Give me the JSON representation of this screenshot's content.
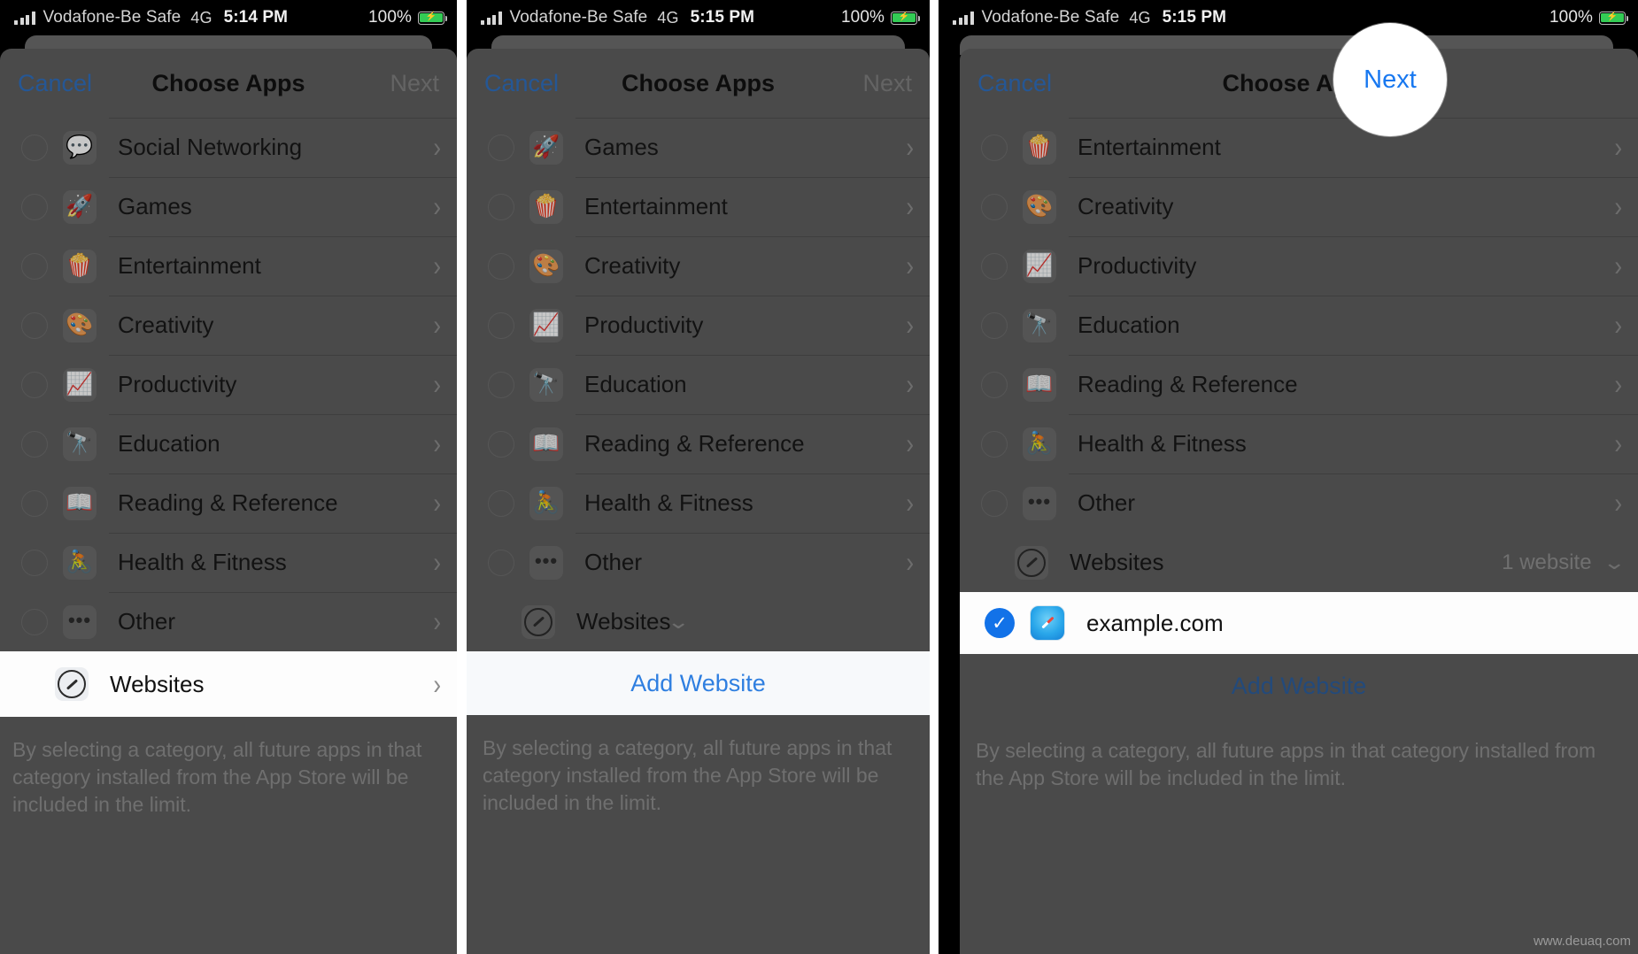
{
  "status_bar": {
    "signal_icon": "cellular-bars-icon",
    "carrier": "Vodafone-Be Safe",
    "network": "4G",
    "time_panel1": "5:14 PM",
    "time_panel2": "5:15 PM",
    "time_panel3": "5:15 PM",
    "battery_percent": "100%",
    "battery_icon": "battery-charging-icon"
  },
  "nav": {
    "cancel_label": "Cancel",
    "title": "Choose Apps",
    "next_label": "Next",
    "next_color_disabled": "#808080",
    "next_color_enabled": "#1878f0",
    "cancel_color": "#2f6fbf"
  },
  "footnote": "By selecting a category, all future apps in that category installed from the App Store will be included in the limit.",
  "add_website_label": "Add Website",
  "panel1": {
    "rows": [
      {
        "label": "Social Networking",
        "icon": "social-networking-icon",
        "glyph": "💬",
        "accessory": "chevron-right-icon"
      },
      {
        "label": "Games",
        "icon": "games-icon",
        "glyph": "🚀",
        "accessory": "chevron-right-icon"
      },
      {
        "label": "Entertainment",
        "icon": "entertainment-icon",
        "glyph": "🍿",
        "accessory": "chevron-right-icon"
      },
      {
        "label": "Creativity",
        "icon": "creativity-icon",
        "glyph": "🎨",
        "accessory": "chevron-right-icon"
      },
      {
        "label": "Productivity",
        "icon": "productivity-icon",
        "glyph": "📈",
        "accessory": "chevron-right-icon"
      },
      {
        "label": "Education",
        "icon": "education-icon",
        "glyph": "🔭",
        "accessory": "chevron-right-icon"
      },
      {
        "label": "Reading & Reference",
        "icon": "reading-reference-icon",
        "glyph": "📖",
        "accessory": "chevron-right-icon"
      },
      {
        "label": "Health & Fitness",
        "icon": "health-fitness-icon",
        "glyph": "🚴",
        "accessory": "chevron-right-icon"
      },
      {
        "label": "Other",
        "icon": "other-icon",
        "glyph": "•••",
        "accessory": "chevron-right-icon"
      }
    ],
    "websites_row": {
      "label": "Websites",
      "icon": "safari-compass-icon",
      "accessory": "chevron-right-icon",
      "highlighted": true
    }
  },
  "panel2": {
    "rows": [
      {
        "label": "Games",
        "icon": "games-icon",
        "glyph": "🚀",
        "accessory": "chevron-right-icon"
      },
      {
        "label": "Entertainment",
        "icon": "entertainment-icon",
        "glyph": "🍿",
        "accessory": "chevron-right-icon"
      },
      {
        "label": "Creativity",
        "icon": "creativity-icon",
        "glyph": "🎨",
        "accessory": "chevron-right-icon"
      },
      {
        "label": "Productivity",
        "icon": "productivity-icon",
        "glyph": "📈",
        "accessory": "chevron-right-icon"
      },
      {
        "label": "Education",
        "icon": "education-icon",
        "glyph": "🔭",
        "accessory": "chevron-right-icon"
      },
      {
        "label": "Reading & Reference",
        "icon": "reading-reference-icon",
        "glyph": "📖",
        "accessory": "chevron-right-icon"
      },
      {
        "label": "Health & Fitness",
        "icon": "health-fitness-icon",
        "glyph": "🚴",
        "accessory": "chevron-right-icon"
      },
      {
        "label": "Other",
        "icon": "other-icon",
        "glyph": "•••",
        "accessory": "chevron-right-icon"
      }
    ],
    "websites_row": {
      "label": "Websites",
      "icon": "safari-compass-icon",
      "accessory": "chevron-down-icon"
    },
    "add_website_highlighted": true
  },
  "panel3": {
    "rows": [
      {
        "label": "Entertainment",
        "icon": "entertainment-icon",
        "glyph": "🍿",
        "accessory": "chevron-right-icon"
      },
      {
        "label": "Creativity",
        "icon": "creativity-icon",
        "glyph": "🎨",
        "accessory": "chevron-right-icon"
      },
      {
        "label": "Productivity",
        "icon": "productivity-icon",
        "glyph": "📈",
        "accessory": "chevron-right-icon"
      },
      {
        "label": "Education",
        "icon": "education-icon",
        "glyph": "🔭",
        "accessory": "chevron-right-icon"
      },
      {
        "label": "Reading & Reference",
        "icon": "reading-reference-icon",
        "glyph": "📖",
        "accessory": "chevron-right-icon"
      },
      {
        "label": "Health & Fitness",
        "icon": "health-fitness-icon",
        "glyph": "🚴",
        "accessory": "chevron-right-icon"
      },
      {
        "label": "Other",
        "icon": "other-icon",
        "glyph": "•••",
        "accessory": "chevron-right-icon"
      }
    ],
    "websites_row": {
      "label": "Websites",
      "icon": "safari-compass-icon",
      "count_label": "1 website",
      "accessory": "chevron-down-icon"
    },
    "selected_website": {
      "label": "example.com",
      "icon": "safari-app-icon",
      "checked": true,
      "check_color": "#1272e8"
    },
    "next_spotlight": true
  },
  "watermark": "www.deuaq.com"
}
